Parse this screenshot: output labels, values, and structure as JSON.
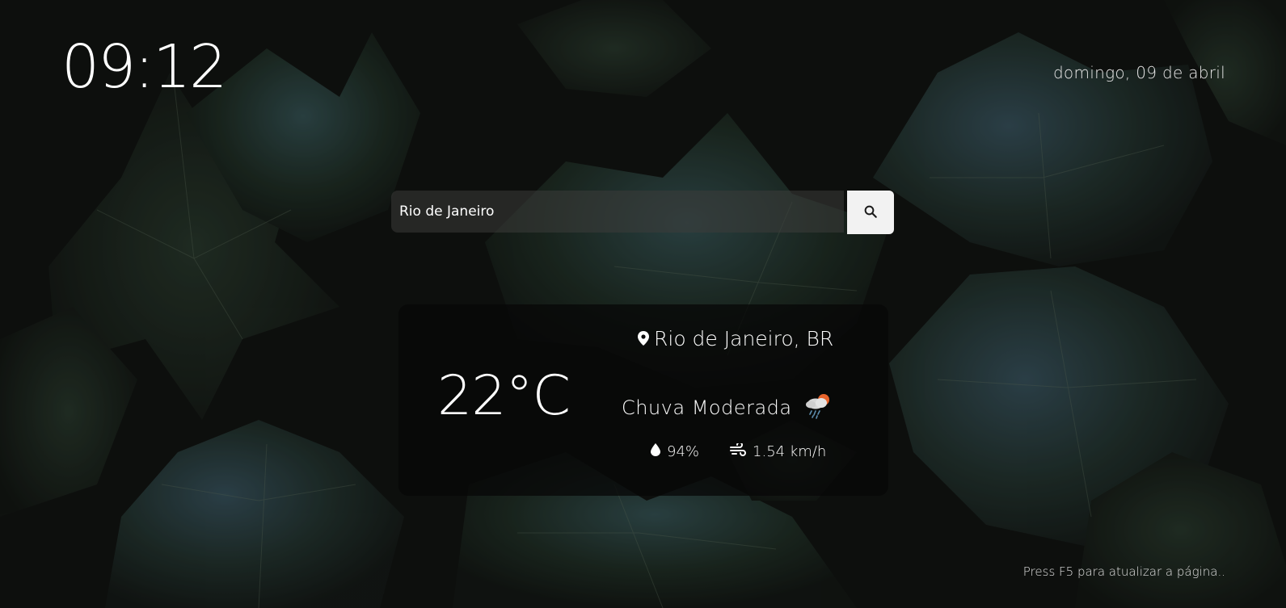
{
  "clock": {
    "time": "09:12"
  },
  "date": {
    "text": "domingo, 09 de abril"
  },
  "search": {
    "value": "Rio de Janeiro",
    "icon": "search-icon"
  },
  "weather": {
    "temperature": "22°C",
    "location": "Rio de Janeiro, BR",
    "condition": "Chuva Moderada",
    "condition_icon": "rain-cloud-sun-icon",
    "humidity": "94%",
    "wind": "1.54 km/h"
  },
  "footer": {
    "hint": "Press F5 para atualizar a página.."
  },
  "colors": {
    "background": "#141614",
    "leaf_dark": "#1f2a22",
    "leaf_teal": "#2e4a4f",
    "card": "#080808",
    "button": "#f2f2f2"
  }
}
